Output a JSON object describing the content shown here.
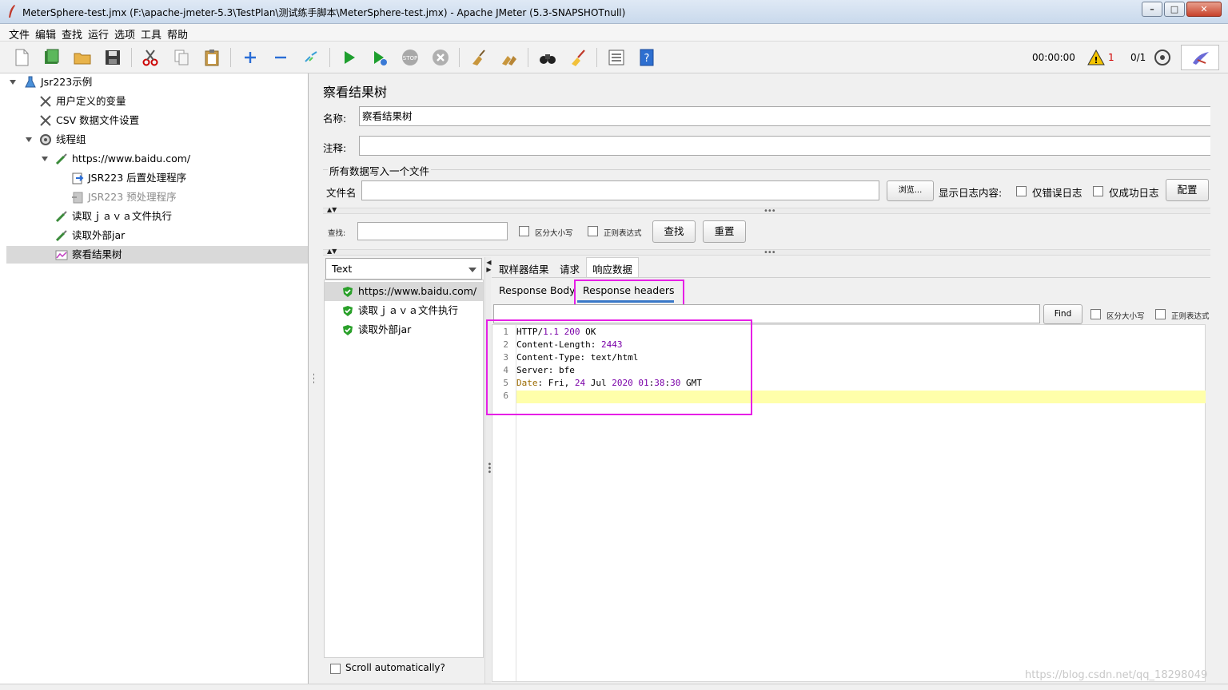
{
  "window": {
    "title": "MeterSphere-test.jmx (F:\\apache-jmeter-5.3\\TestPlan\\测试练手脚本\\MeterSphere-test.jmx) - Apache JMeter (5.3-SNAPSHOTnull)"
  },
  "menu": [
    "文件",
    "编辑",
    "查找",
    "运行",
    "选项",
    "工具",
    "帮助"
  ],
  "toolbar": {
    "timer": "00:00:00",
    "warnings": "1",
    "threads": "0/1"
  },
  "tree": {
    "root": "Jsr223示例",
    "items": [
      {
        "label": "用户定义的变量"
      },
      {
        "label": "CSV 数据文件设置"
      },
      {
        "label": "线程组"
      },
      {
        "label": "https://www.baidu.com/"
      },
      {
        "label": "JSR223 后置处理程序"
      },
      {
        "label": "JSR223 预处理程序"
      },
      {
        "label": "读取ｊａｖａ文件执行"
      },
      {
        "label": "读取外部jar"
      },
      {
        "label": "察看结果树"
      }
    ]
  },
  "panel": {
    "title": "察看结果树",
    "name_label": "名称:",
    "name_value": "察看结果树",
    "comment_label": "注释:",
    "comment_value": "",
    "section_label": "所有数据写入一个文件",
    "filename_label": "文件名",
    "filename_value": "",
    "browse_button": "浏览...",
    "log_label": "显示日志内容:",
    "errors_only": "仅错误日志",
    "success_only": "仅成功日志",
    "config_button": "配置"
  },
  "search": {
    "label": "查找:",
    "value": "",
    "case_sensitive": "区分大小写",
    "regex": "正则表达式",
    "find_button": "查找",
    "reset_button": "重置"
  },
  "renderer": {
    "selected": "Text"
  },
  "results": [
    {
      "label": "https://www.baidu.com/",
      "selected": true
    },
    {
      "label": "读取ｊａｖａ文件执行",
      "selected": false
    },
    {
      "label": "读取外部jar",
      "selected": false
    }
  ],
  "scroll_auto": "Scroll automatically?",
  "tabs": [
    "取样器结果",
    "请求",
    "响应数据"
  ],
  "subtabs": [
    "Response Body",
    "Response headers"
  ],
  "editor_search": {
    "value": "",
    "find_button": "Find",
    "case_sensitive": "区分大小写",
    "regex": "正则表达式"
  },
  "response_lines": [
    {
      "n": "1",
      "text": "HTTP/1.1 200 OK"
    },
    {
      "n": "2",
      "text": "Content-Length: 2443"
    },
    {
      "n": "3",
      "text": "Content-Type: text/html"
    },
    {
      "n": "4",
      "text": "Server: bfe"
    },
    {
      "n": "5",
      "text": "Date: Fri, 24 Jul 2020 01:38:30 GMT"
    },
    {
      "n": "6",
      "text": ""
    }
  ],
  "watermark": "https://blog.csdn.net/qq_18298049",
  "colors": {
    "highlight_box": "#e61fe6",
    "current_line": "#ffffaa",
    "selection": "#d9d9d9"
  }
}
